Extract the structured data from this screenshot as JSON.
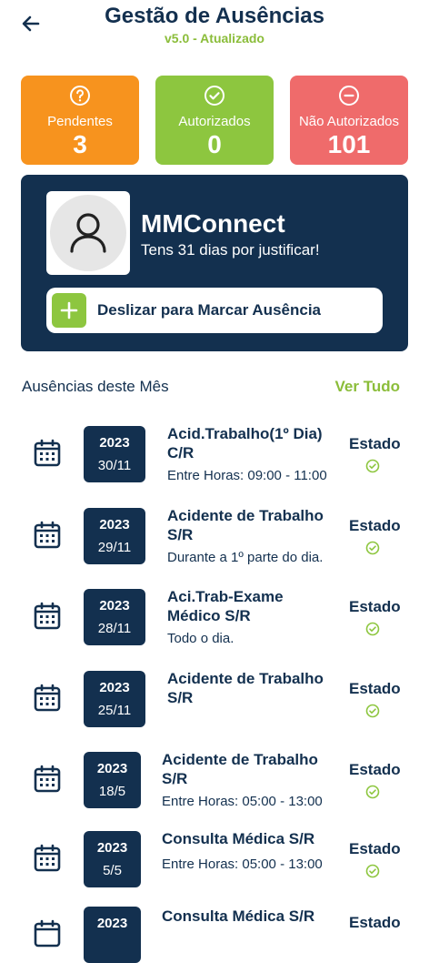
{
  "header": {
    "title": "Gestão de Ausências",
    "subtitle": "v5.0 - Atualizado"
  },
  "stats": [
    {
      "label": "Pendentes",
      "value": "3",
      "icon": "help-circle-icon",
      "color": "#f7931e"
    },
    {
      "label": "Autorizados",
      "value": "0",
      "icon": "check-circle-icon",
      "color": "#8dc63f"
    },
    {
      "label": "Não Autorizados",
      "value": "101",
      "icon": "minus-circle-icon",
      "color": "#ef6b6b"
    }
  ],
  "profile": {
    "name": "MMConnect",
    "message": "Tens 31 dias por justificar!",
    "slide_label": "Deslizar para Marcar Ausência"
  },
  "section": {
    "title": "Ausências deste Mês",
    "link": "Ver Tudo"
  },
  "absences": [
    {
      "year": "2023",
      "date": "30/11",
      "title": "Acid.Trabalho(1º Dia) C/R",
      "detail": "Entre Horas: 09:00 - 11:00",
      "status": "Estado"
    },
    {
      "year": "2023",
      "date": "29/11",
      "title": "Acidente de Trabalho S/R",
      "detail": "Durante a 1º parte do dia.",
      "status": "Estado"
    },
    {
      "year": "2023",
      "date": "28/11",
      "title": "Aci.Trab-Exame Médico S/R",
      "detail": "Todo o dia.",
      "status": "Estado"
    },
    {
      "year": "2023",
      "date": "25/11",
      "title": "Acidente de Trabalho S/R",
      "detail": "",
      "status": "Estado"
    },
    {
      "year": "2023",
      "date": "18/5",
      "title": "Acidente de Trabalho S/R",
      "detail": "Entre Horas: 05:00 - 13:00",
      "status": "Estado"
    },
    {
      "year": "2023",
      "date": "5/5",
      "title": "Consulta Médica S/R",
      "detail": "Entre Horas: 05:00 - 13:00",
      "status": "Estado"
    },
    {
      "year": "2023",
      "date": "",
      "title": "Consulta Médica S/R",
      "detail": "",
      "status": "Estado"
    }
  ],
  "colors": {
    "navy": "#13304f",
    "green": "#8dc63f",
    "orange": "#f7931e",
    "red": "#ef6b6b"
  }
}
